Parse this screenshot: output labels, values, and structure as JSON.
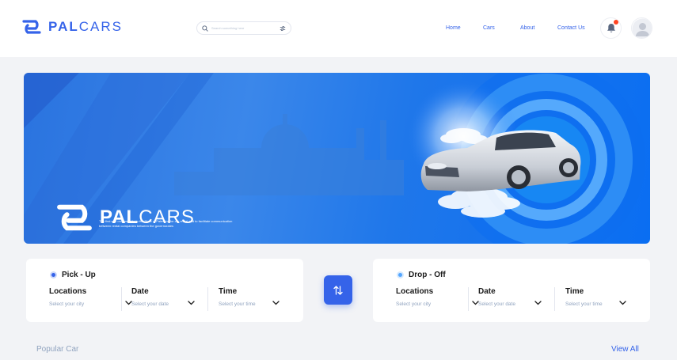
{
  "header": {
    "logo_bold": "PAL",
    "logo_light": "CARS",
    "search_placeholder": "Search something here",
    "nav": [
      "Home",
      "Cars",
      "About",
      "Contact Us"
    ]
  },
  "hero": {
    "brand_bold": "PAL",
    "brand_light": "CARS",
    "tagline": "The first and only website in the State of Palestine for car rental and to facilitate communication between rental companies between the governorates"
  },
  "pickup": {
    "title": "Pick - Up",
    "location_label": "Locations",
    "location_placeholder": "Select your city",
    "date_label": "Date",
    "date_placeholder": "Select your date",
    "time_label": "Time",
    "time_placeholder": "Select your time"
  },
  "dropoff": {
    "title": "Drop - Off",
    "location_label": "Locations",
    "location_placeholder": "Select your city",
    "date_label": "Date",
    "date_placeholder": "Select your date",
    "time_label": "Time",
    "time_placeholder": "Select your time"
  },
  "popular": {
    "title": "Popular Car",
    "view_all": "View All"
  },
  "icons": {
    "search": "search-icon",
    "filter": "filter-icon",
    "bell": "bell-icon",
    "avatar": "user-avatar-icon",
    "chevron": "chevron-down-icon",
    "swap": "swap-arrows-icon"
  },
  "colors": {
    "primary": "#3563e9",
    "notification": "#ff4423",
    "muted": "#90a3bf"
  }
}
